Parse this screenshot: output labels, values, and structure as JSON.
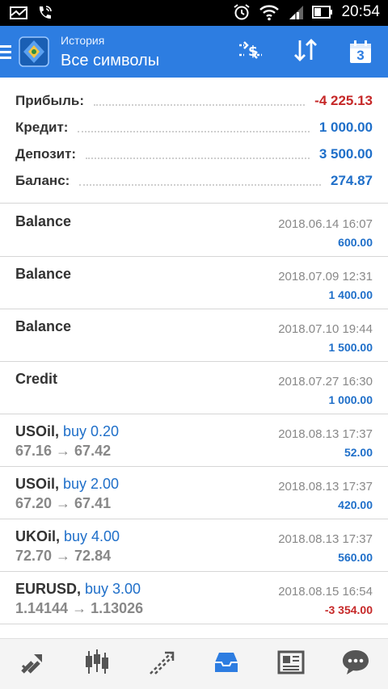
{
  "status": {
    "time": "20:54",
    "icons": [
      "mail-icon",
      "phone-icon",
      "alarm-icon",
      "wifi-icon",
      "signal-icon",
      "battery-icon"
    ]
  },
  "appbar": {
    "title": "История",
    "subtitle": "Все символы",
    "calendar_day": "3",
    "actions": [
      "currency-filter-icon",
      "sort-icon",
      "calendar-icon"
    ]
  },
  "summary": [
    {
      "label": "Прибыль:",
      "value": "-4 225.13",
      "color": "#c62828"
    },
    {
      "label": "Кредит:",
      "value": "1 000.00",
      "color": "#1f6fc9"
    },
    {
      "label": "Депозит:",
      "value": "3 500.00",
      "color": "#1f6fc9"
    },
    {
      "label": "Баланс:",
      "value": "274.87",
      "color": "#1f6fc9"
    }
  ],
  "entries": [
    {
      "symbol": "Balance",
      "deal": "",
      "price": "",
      "time": "2018.06.14 16:07",
      "profit": "600.00",
      "negative": false
    },
    {
      "symbol": "Balance",
      "deal": "",
      "price": "",
      "time": "2018.07.09 12:31",
      "profit": "1 400.00",
      "negative": false
    },
    {
      "symbol": "Balance",
      "deal": "",
      "price": "",
      "time": "2018.07.10 19:44",
      "profit": "1 500.00",
      "negative": false
    },
    {
      "symbol": "Credit",
      "deal": "",
      "price": "",
      "time": "2018.07.27 16:30",
      "profit": "1 000.00",
      "negative": false
    },
    {
      "symbol": "USOil,",
      "deal": " buy 0.20",
      "price": "67.16 → 67.42",
      "time": "2018.08.13 17:37",
      "profit": "52.00",
      "negative": false
    },
    {
      "symbol": "USOil,",
      "deal": " buy 2.00",
      "price": "67.20 → 67.41",
      "time": "2018.08.13 17:37",
      "profit": "420.00",
      "negative": false
    },
    {
      "symbol": "UKOil,",
      "deal": " buy 4.00",
      "price": "72.70 → 72.84",
      "time": "2018.08.13 17:37",
      "profit": "560.00",
      "negative": false
    },
    {
      "symbol": "EURUSD,",
      "deal": " buy 3.00",
      "price": "1.14144 → 1.13026",
      "time": "2018.08.15 16:54",
      "profit": "-3 354.00",
      "negative": true
    }
  ],
  "bottom_nav": [
    {
      "name": "quotes-icon",
      "active": false
    },
    {
      "name": "chart-icon",
      "active": false
    },
    {
      "name": "trade-icon",
      "active": false
    },
    {
      "name": "history-icon",
      "active": true
    },
    {
      "name": "news-icon",
      "active": false
    },
    {
      "name": "chat-icon",
      "active": false
    }
  ],
  "colors": {
    "appbar": "#2d7de1",
    "profit_negative": "#c62828",
    "profit_positive": "#1f6fc9",
    "nav_active": "#2d7de1",
    "nav_inactive": "#555555"
  }
}
